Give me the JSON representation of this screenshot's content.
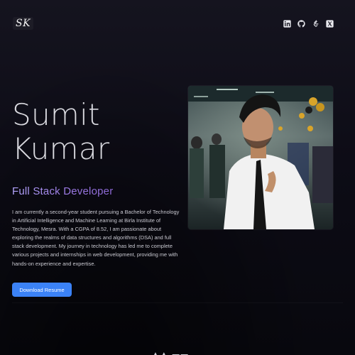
{
  "nav": {
    "logo": "SK",
    "socials": [
      {
        "icon": "linkedin-icon"
      },
      {
        "icon": "github-icon"
      },
      {
        "icon": "leetcode-icon"
      },
      {
        "icon": "x-twitter-icon"
      }
    ]
  },
  "hero": {
    "first_name": "Sumit",
    "last_name": "Kumar",
    "role": "Full Stack Developer",
    "bio": "I am currently a second-year student pursuing a Bachelor of Technology in Artificial Intelligence and Machine Learning at Birla Institute of Technology, Mesra. With a CGPA of 8.52, I am passionate about exploring the realms of data structures and algorithms (DSA) and full stack development. My journey in technology has led me to complete various projects and internships in web development, providing me with hands-on experience and expertise.",
    "resume_button": "Download Resume"
  },
  "colors": {
    "accent": "#3b82f6",
    "role_gradient_start": "#b5a7ff",
    "role_gradient_end": "#8d68d6",
    "background": "#0d0c16"
  }
}
